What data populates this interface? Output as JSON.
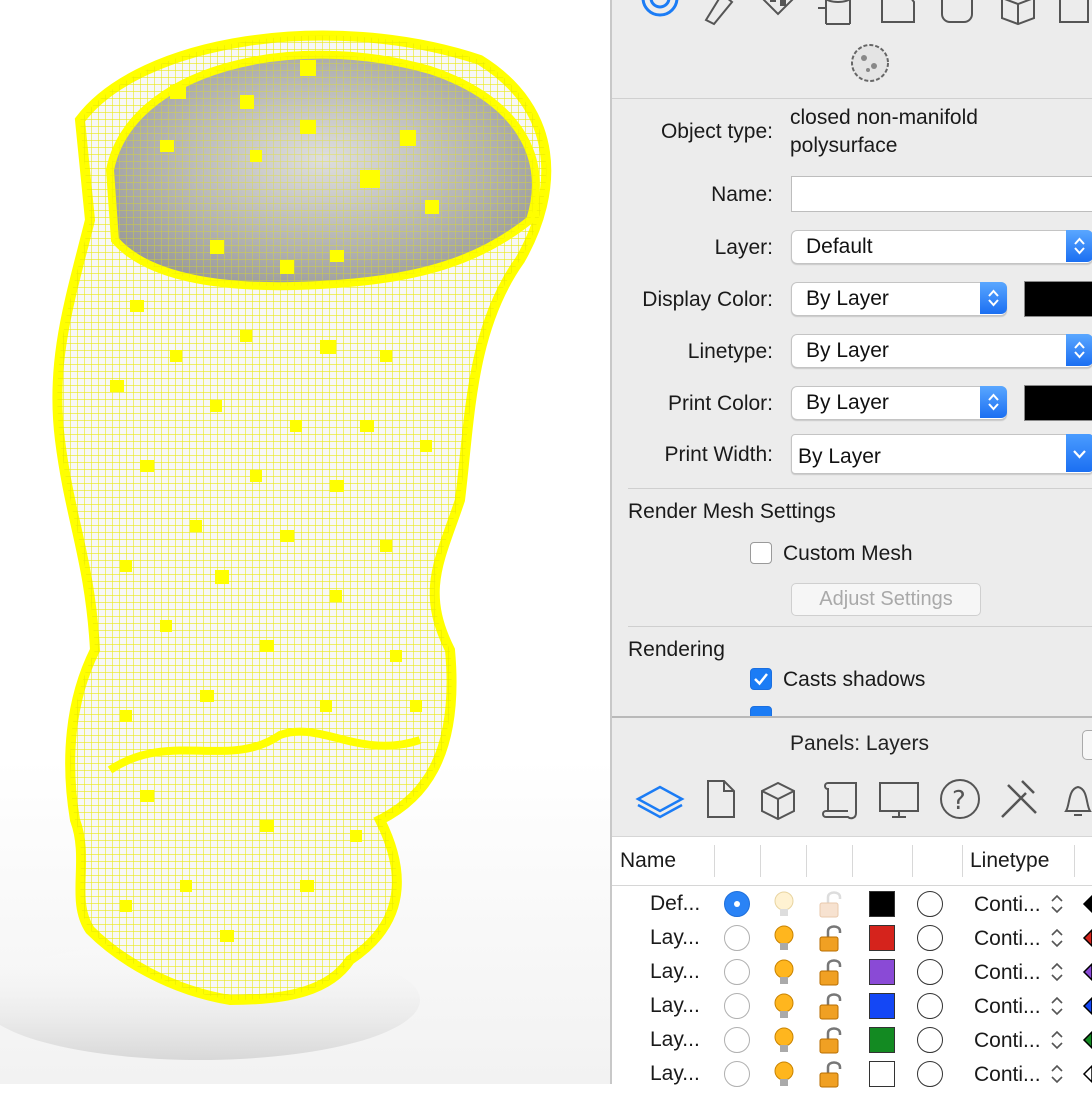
{
  "properties": {
    "object_type_label": "Object type:",
    "object_type_line1": "closed non-manifold",
    "object_type_line2": "polysurface",
    "name_label": "Name:",
    "name_value": "",
    "layer_label": "Layer:",
    "layer_value": "Default",
    "display_color_label": "Display Color:",
    "display_color_value": "By Layer",
    "linetype_label": "Linetype:",
    "linetype_value": "By Layer",
    "print_color_label": "Print Color:",
    "print_color_value": "By Layer",
    "print_width_label": "Print Width:",
    "print_width_value": "By Layer",
    "render_mesh_heading": "Render Mesh Settings",
    "custom_mesh_label": "Custom Mesh",
    "custom_mesh_checked": false,
    "adjust_settings_label": "Adjust Settings",
    "rendering_heading": "Rendering",
    "casts_shadows_label": "Casts shadows",
    "casts_shadows_checked": true,
    "swatch_color": "#000000"
  },
  "layers_panel": {
    "title": "Panels: Layers",
    "col_name": "Name",
    "col_linetype": "Linetype",
    "icons": [
      "layers-icon",
      "document-icon",
      "cube-icon",
      "scroll-icon",
      "monitor-icon",
      "help-icon",
      "tools-icon",
      "bell-icon"
    ],
    "rows": [
      {
        "name": "Def...",
        "current": true,
        "on": false,
        "locked": false,
        "color": "#000000",
        "linetype": "Conti...",
        "mat": "#000000"
      },
      {
        "name": "Lay...",
        "current": false,
        "on": true,
        "locked": true,
        "color": "#d5231c",
        "linetype": "Conti...",
        "mat": "#d5231c"
      },
      {
        "name": "Lay...",
        "current": false,
        "on": true,
        "locked": true,
        "color": "#8a4ad6",
        "linetype": "Conti...",
        "mat": "#8a4ad6"
      },
      {
        "name": "Lay...",
        "current": false,
        "on": true,
        "locked": true,
        "color": "#1447f5",
        "linetype": "Conti...",
        "mat": "#1447f5"
      },
      {
        "name": "Lay...",
        "current": false,
        "on": true,
        "locked": true,
        "color": "#138a22",
        "linetype": "Conti...",
        "mat": "#138a22"
      },
      {
        "name": "Lay...",
        "current": false,
        "on": true,
        "locked": true,
        "color": "#ffffff",
        "linetype": "Conti...",
        "mat": "#ffffff"
      }
    ]
  },
  "colors": {
    "accent": "#1b7cf5",
    "wire": "#ffff00"
  }
}
